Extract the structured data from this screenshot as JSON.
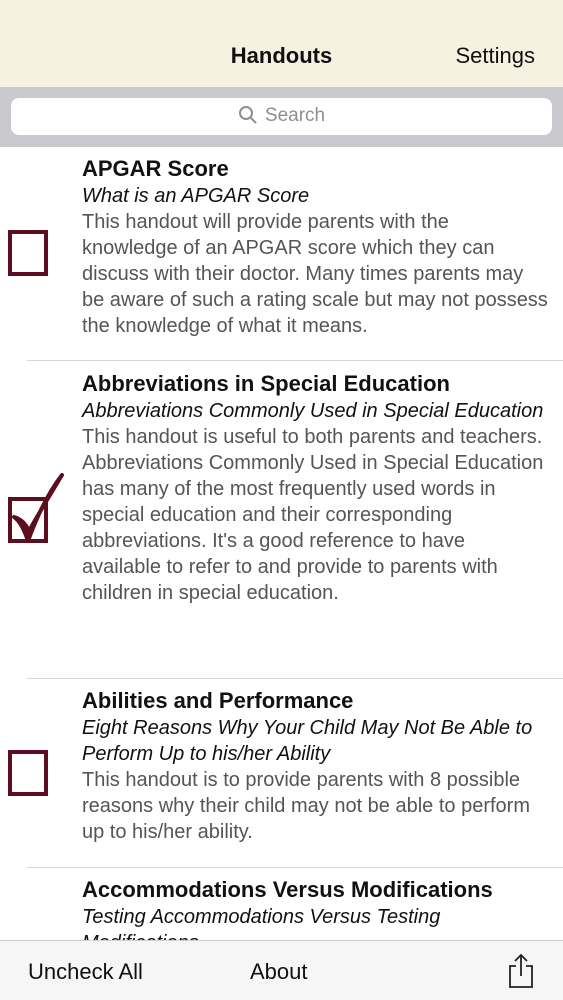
{
  "navbar": {
    "title": "Handouts",
    "right_label": "Settings"
  },
  "search": {
    "placeholder": "Search"
  },
  "items": [
    {
      "title": "APGAR Score",
      "subtitle": "What is an APGAR Score",
      "description": "This handout will provide parents with the knowledge of an APGAR score which they can discuss with their doctor. Many times parents may be aware of such a rating scale but may not possess the knowledge of what it means.",
      "checked": false
    },
    {
      "title": "Abbreviations in Special Education",
      "subtitle": "Abbreviations Commonly Used in Special Education",
      "description": "This handout is useful to both parents and teachers. Abbreviations Commonly Used in Special Education has many of the most frequently used words in special education and their corresponding  abbreviations.  It's a good reference to have available to refer to and provide to parents with children in special education.",
      "checked": true
    },
    {
      "title": "Abilities and Performance",
      "subtitle": "Eight Reasons Why Your Child May Not Be Able to Perform Up to his/her Ability",
      "description": "This handout is to provide parents with 8 possible reasons why their child may not be able to perform up to his/her ability.",
      "checked": false
    },
    {
      "title": "Accommodations Versus Modifications",
      "subtitle": "Testing Accommodations Versus Testing Modifications",
      "description": "",
      "checked": false
    }
  ],
  "toolbar": {
    "uncheck_all_label": "Uncheck All",
    "about_label": "About",
    "share_icon": "share-icon"
  },
  "colors": {
    "navbar_bg": "#f6f1e1",
    "checkbox_border": "#5b0f1e",
    "search_strip": "#c9c9ce"
  }
}
